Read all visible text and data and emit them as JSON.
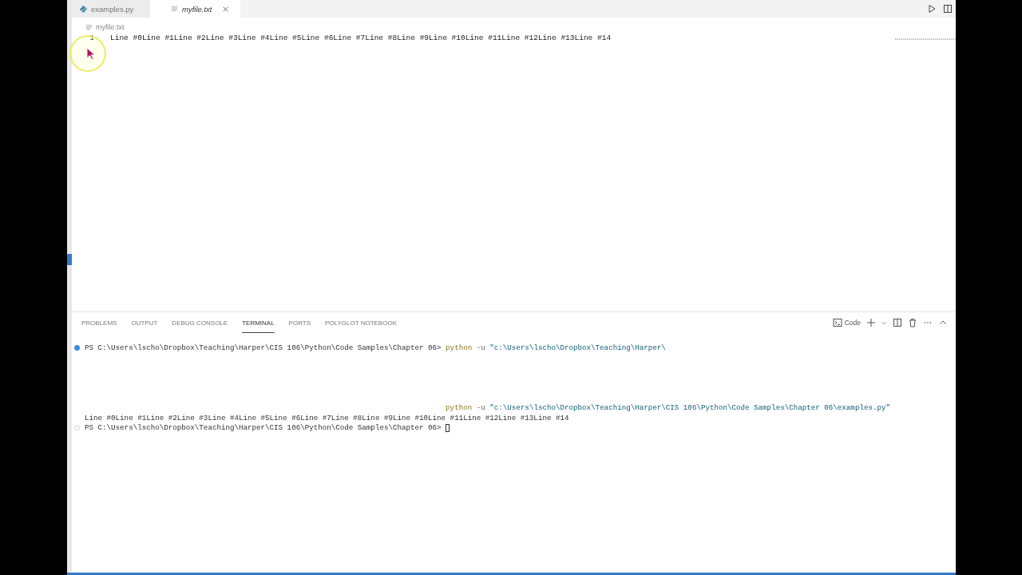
{
  "tabs": [
    {
      "label": "examples.py",
      "kind": "python",
      "selected": false,
      "preview": false
    },
    {
      "label": "myfile.txt",
      "kind": "text",
      "selected": true,
      "preview": true
    }
  ],
  "breadcrumb": "myfile.txt",
  "editor": {
    "lines": [
      {
        "number": "1",
        "text": "Line #0Line #1Line #2Line #3Line #4Line #5Line #6Line #7Line #8Line #9Line #10Line #11Line #12Line #13Line #14"
      }
    ]
  },
  "panel": {
    "tabs": [
      {
        "label": "PROBLEMS",
        "selected": false
      },
      {
        "label": "OUTPUT",
        "selected": false
      },
      {
        "label": "DEBUG CONSOLE",
        "selected": false
      },
      {
        "label": "TERMINAL",
        "selected": true
      },
      {
        "label": "PORTS",
        "selected": false
      },
      {
        "label": "POLYGLOT NOTEBOOK",
        "selected": false
      }
    ],
    "terminal_name": "Code"
  },
  "terminal": {
    "lines": [
      {
        "kind": "prompt",
        "status_dot": true,
        "completed": true,
        "segments": [
          {
            "kind": "prompt",
            "text": "PS C:\\Users\\lscho\\Dropbox\\Teaching\\Harper\\CIS 106\\Python\\Code Samples\\Chapter 06> "
          },
          {
            "kind": "command",
            "text": "python"
          },
          {
            "kind": "flag",
            "text": " -u "
          },
          {
            "kind": "string",
            "text": "\"c:\\Users\\lscho\\Dropbox\\Teaching\\Harper\\"
          }
        ]
      },
      {
        "kind": "echo",
        "status_dot": false,
        "segments": [
          {
            "kind": "command",
            "text": "python"
          },
          {
            "kind": "flag",
            "text": " -u "
          },
          {
            "kind": "string",
            "text": "\"c:\\Users\\lscho\\Dropbox\\Teaching\\Harper\\CIS 106\\Python\\Code Samples\\Chapter 06\\examples.py\""
          }
        ]
      },
      {
        "kind": "output",
        "status_dot": false,
        "segments": [
          {
            "kind": "output",
            "text": "Line #0Line #1Line #2Line #3Line #4Line #5Line #6Line #7Line #8Line #9Line #10Line #11Line #12Line #13Line #14"
          }
        ]
      },
      {
        "kind": "prompt",
        "status_dot": true,
        "completed": false,
        "cursor": true,
        "segments": [
          {
            "kind": "prompt",
            "text": "PS C:\\Users\\lscho\\Dropbox\\Teaching\\Harper\\CIS 106\\Python\\Code Samples\\Chapter 06> "
          }
        ]
      }
    ]
  }
}
